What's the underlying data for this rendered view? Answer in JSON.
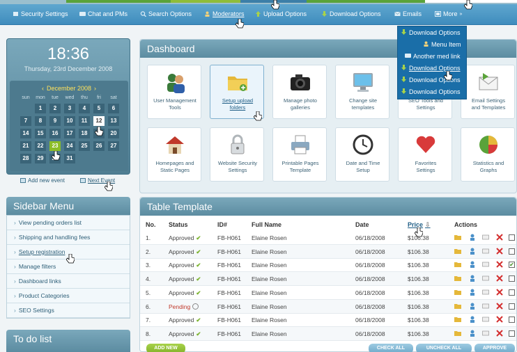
{
  "nav": {
    "items": [
      {
        "label": "Security Settings",
        "icon": "gear-icon"
      },
      {
        "label": "Chat and PMs",
        "icon": "chat-icon"
      },
      {
        "label": "Search Options",
        "icon": "search-icon"
      },
      {
        "label": "Moderators",
        "icon": "user-icon"
      },
      {
        "label": "Upload Options",
        "icon": "upload-icon"
      },
      {
        "label": "Download Options",
        "icon": "download-icon"
      },
      {
        "label": "Emails",
        "icon": "mail-icon"
      },
      {
        "label": "More",
        "icon": "more-icon"
      }
    ],
    "dropdown": [
      {
        "label": "Download Options",
        "icon": "download-icon"
      },
      {
        "label": "Menu Item",
        "icon": "user-icon"
      },
      {
        "label": "Another med link",
        "icon": "chat-icon"
      },
      {
        "label": "Download Options",
        "icon": "download-icon"
      },
      {
        "label": "Download Options",
        "icon": "download-icon"
      },
      {
        "label": "Download Options",
        "icon": "download-icon"
      }
    ]
  },
  "clock": {
    "time": "18:36",
    "date": "Thursday, 23rd December 2008"
  },
  "calendar": {
    "month": "December 2008",
    "prev": "‹",
    "next": "›",
    "dows": [
      "sun",
      "mon",
      "tue",
      "wed",
      "thu",
      "fri",
      "sat"
    ],
    "weeks": [
      [
        "",
        "1",
        "2",
        "3",
        "4",
        "5",
        "6"
      ],
      [
        "7",
        "8",
        "9",
        "10",
        "11",
        "12",
        "13"
      ],
      [
        "14",
        "15",
        "16",
        "17",
        "18",
        "19",
        "20"
      ],
      [
        "21",
        "22",
        "23",
        "24",
        "25",
        "26",
        "27"
      ],
      [
        "28",
        "29",
        "30",
        "31",
        "",
        "",
        ""
      ]
    ],
    "today": "23",
    "selected": "12",
    "add_event": "Add new event",
    "next_event": "Next Event"
  },
  "sidebar": {
    "title": "Sidebar Menu",
    "items": [
      {
        "label": "View pending orders list"
      },
      {
        "label": "Shipping and handling fees"
      },
      {
        "label": "Setup registration"
      },
      {
        "label": "Manage filters"
      },
      {
        "label": "Dashboard links"
      },
      {
        "label": "Product Categories"
      },
      {
        "label": "SEO Settings"
      }
    ]
  },
  "todo": {
    "title": "To do list"
  },
  "dashboard": {
    "title": "Dashboard",
    "tiles": [
      {
        "line1": "User Management",
        "line2": "Tools",
        "icon": "users-icon"
      },
      {
        "line1": "Setup upload",
        "line2": "folders",
        "icon": "folder-icon"
      },
      {
        "line1": "Manage photo",
        "line2": "galleries",
        "icon": "camera-icon"
      },
      {
        "line1": "Change site",
        "line2": "templates",
        "icon": "monitor-icon"
      },
      {
        "line1": "SEO Tools and",
        "line2": "Settings",
        "icon": "seo-icon"
      },
      {
        "line1": "Email Settings",
        "line2": "and Templates",
        "icon": "mail-icon"
      },
      {
        "line1": "Homepages and",
        "line2": "Static Pages",
        "icon": "home-icon"
      },
      {
        "line1": "Website Security",
        "line2": "Settings",
        "icon": "lock-icon"
      },
      {
        "line1": "Printable Pages",
        "line2": "Template",
        "icon": "printer-icon"
      },
      {
        "line1": "Date and Time",
        "line2": "Setup",
        "icon": "clock-icon"
      },
      {
        "line1": "Favorites",
        "line2": "Settings",
        "icon": "heart-icon"
      },
      {
        "line1": "Statistics and",
        "line2": "Graphs",
        "icon": "pie-icon"
      }
    ]
  },
  "table": {
    "title": "Table Template",
    "headers": {
      "no": "No.",
      "status": "Status",
      "id": "ID#",
      "name": "Full Name",
      "date": "Date",
      "price": "Price",
      "actions": "Actions"
    },
    "rows": [
      {
        "no": "1.",
        "status": "Approved",
        "id": "FB-H061",
        "name": "Elaine Rosen",
        "date": "06/18/2008",
        "price": "$106.38",
        "checked": false
      },
      {
        "no": "2.",
        "status": "Approved",
        "id": "FB-H061",
        "name": "Elaine Rosen",
        "date": "06/18/2008",
        "price": "$106.38",
        "checked": false
      },
      {
        "no": "3.",
        "status": "Approved",
        "id": "FB-H061",
        "name": "Elaine Rosen",
        "date": "06/18/2008",
        "price": "$106.38",
        "checked": true
      },
      {
        "no": "4.",
        "status": "Approved",
        "id": "FB-H061",
        "name": "Elaine Rosen",
        "date": "06/18/2008",
        "price": "$106.38",
        "checked": false
      },
      {
        "no": "5.",
        "status": "Approved",
        "id": "FB-H061",
        "name": "Elaine Rosen",
        "date": "06/18/2008",
        "price": "$106.38",
        "checked": false
      },
      {
        "no": "6.",
        "status": "Pending",
        "id": "FB-H061",
        "name": "Elaine Rosen",
        "date": "06/18/2008",
        "price": "$106.38",
        "checked": false
      },
      {
        "no": "7.",
        "status": "Approved",
        "id": "FB-H061",
        "name": "Elaine Rosen",
        "date": "06/18/2008",
        "price": "$106.38",
        "checked": false
      },
      {
        "no": "8.",
        "status": "Approved",
        "id": "FB-H061",
        "name": "Elaine Rosen",
        "date": "06/18/2008",
        "price": "$106.38",
        "checked": false
      }
    ],
    "buttons": {
      "add": "ADD NEW",
      "check_all": "CHECK ALL",
      "uncheck_all": "UNCHECK ALL",
      "approve": "APPROVE"
    }
  }
}
